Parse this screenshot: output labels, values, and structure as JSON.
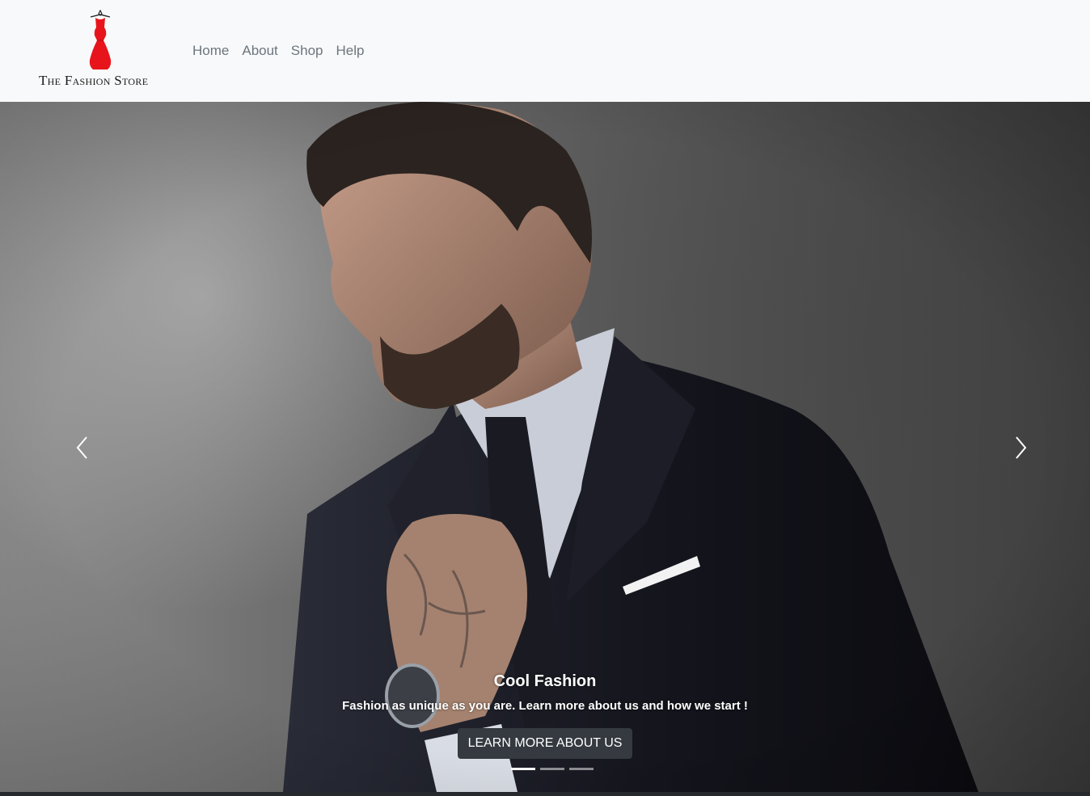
{
  "brand": {
    "name": "The Fashion Store",
    "logo_icon": "dress-icon",
    "logo_color": "#e8141b"
  },
  "nav": {
    "items": [
      {
        "label": "Home"
      },
      {
        "label": "About"
      },
      {
        "label": "Shop"
      },
      {
        "label": "Help"
      }
    ]
  },
  "carousel": {
    "prev_icon": "chevron-left-icon",
    "next_icon": "chevron-right-icon",
    "slide": {
      "title": "Cool Fashion",
      "text": "Fashion as unique as you are. Learn more about us and how we start !",
      "button_label": "LEARN MORE ABOUT US"
    },
    "indicators": {
      "count": 3,
      "active_index": 0
    }
  },
  "colors": {
    "navbar_bg": "#f8f9fa",
    "nav_link": "#6c757d",
    "button_bg": "#343a40"
  }
}
